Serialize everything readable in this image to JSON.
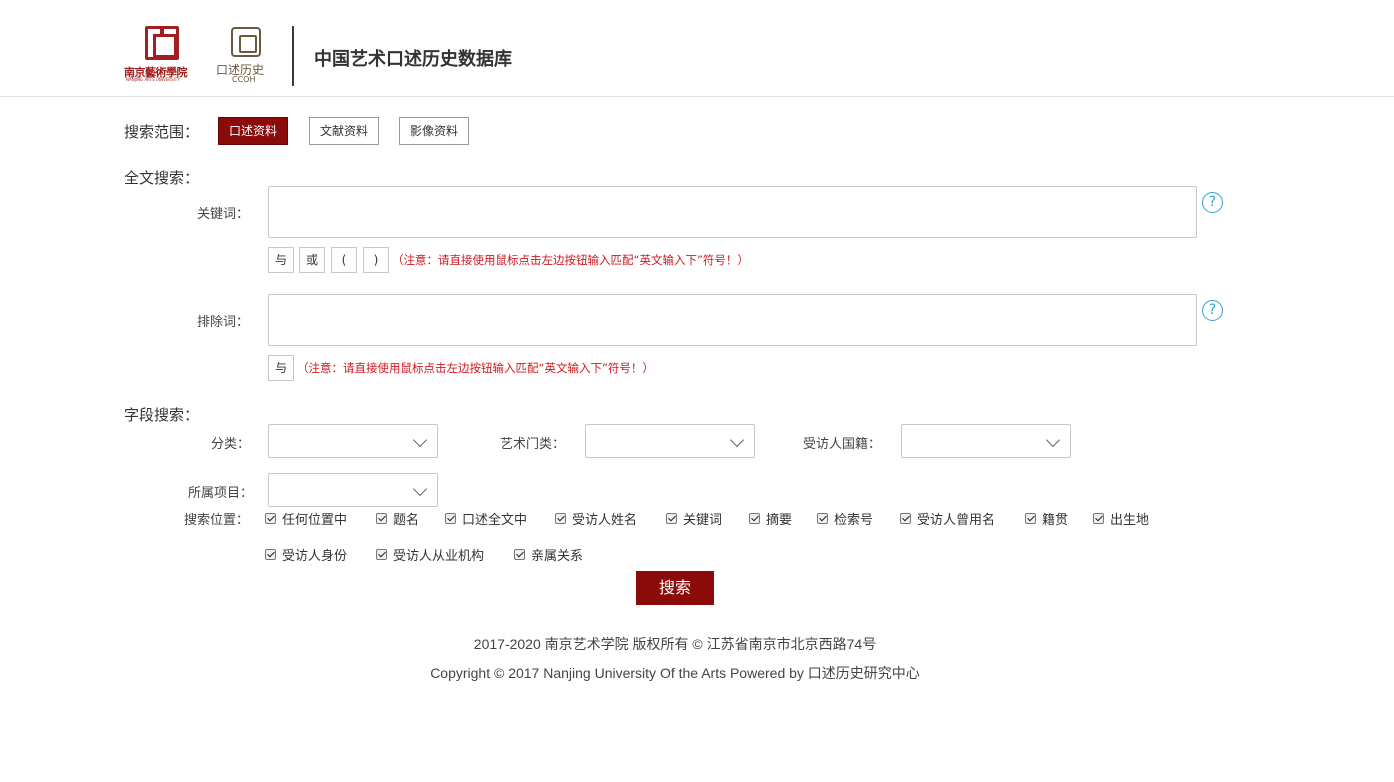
{
  "header": {
    "nua_logo_cn": "南京藝術學院",
    "nua_logo_en": "NANJING ARTS UNIVERSITY",
    "ccoh_logo_cn": "口述历史",
    "ccoh_logo_en": "CCOH",
    "site_title": "中国艺术口述历史数据库"
  },
  "scope": {
    "label": "搜索范围：",
    "buttons": [
      {
        "label": "口述资料",
        "active": true
      },
      {
        "label": "文献资料",
        "active": false
      },
      {
        "label": "影像资料",
        "active": false
      }
    ]
  },
  "fulltext": {
    "section_label": "全文搜索：",
    "keyword_label": "关键词：",
    "keyword_value": "",
    "keyword_ops": [
      "与",
      "或",
      "(",
      ")"
    ],
    "keyword_note": "（注意：请直接使用鼠标点击左边按钮输入匹配“英文输入下”符号！）",
    "exclude_label": "排除词：",
    "exclude_value": "",
    "exclude_ops": [
      "与"
    ],
    "exclude_note": "（注意：请直接使用鼠标点击左边按钮输入匹配“英文输入下”符号！）",
    "help_glyph": "?"
  },
  "fields": {
    "section_label": "字段搜索：",
    "category_label": "分类：",
    "category_value": "",
    "art_label": "艺术门类：",
    "art_value": "",
    "nationality_label": "受访人国籍：",
    "nationality_value": "",
    "project_label": "所属项目：",
    "project_value": "",
    "position_label": "搜索位置：",
    "positions_row1": [
      {
        "label": "任何位置中",
        "checked": true
      },
      {
        "label": "题名",
        "checked": true
      },
      {
        "label": "口述全文中",
        "checked": true
      },
      {
        "label": "受访人姓名",
        "checked": true
      },
      {
        "label": "关键词",
        "checked": true
      },
      {
        "label": "摘要",
        "checked": true
      },
      {
        "label": "检索号",
        "checked": true
      },
      {
        "label": "受访人曾用名",
        "checked": true
      },
      {
        "label": "籍贯",
        "checked": true
      },
      {
        "label": "出生地",
        "checked": true
      }
    ],
    "positions_row2": [
      {
        "label": "受访人身份",
        "checked": true
      },
      {
        "label": "受访人从业机构",
        "checked": true
      },
      {
        "label": "亲属关系",
        "checked": true
      }
    ]
  },
  "search_button": "搜索",
  "footer": {
    "line1": "2017-2020 南京艺术学院 版权所有 © 江苏省南京市北京西路74号",
    "line2": "Copyright © 2017 Nanjing University Of the Arts Powered by 口述历史研究中心"
  }
}
